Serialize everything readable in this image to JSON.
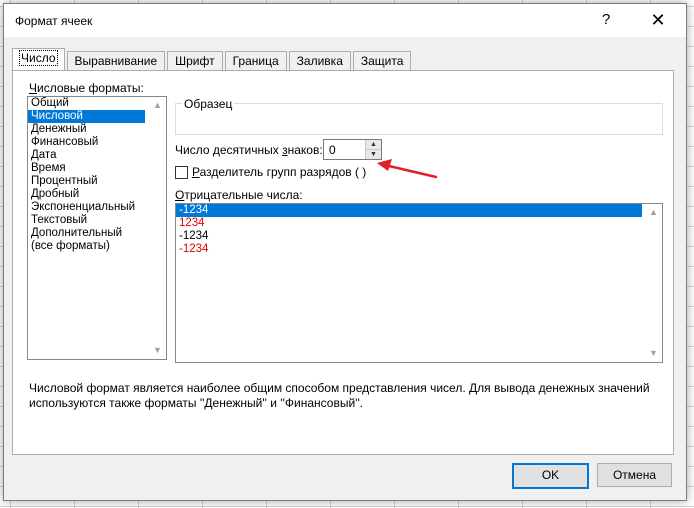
{
  "window": {
    "title": "Формат ячеек",
    "help_glyph": "?",
    "close_glyph": "✕"
  },
  "tabs": [
    {
      "label": "Число",
      "active": true
    },
    {
      "label": "Выравнивание"
    },
    {
      "label": "Шрифт"
    },
    {
      "label": "Граница"
    },
    {
      "label": "Заливка"
    },
    {
      "label": "Защита"
    }
  ],
  "categories": {
    "label_u": "Ч",
    "label_rest": "исловые форматы:",
    "items": [
      "Общий",
      "Числовой",
      "Денежный",
      "Финансовый",
      "Дата",
      "Время",
      "Процентный",
      "Дробный",
      "Экспоненциальный",
      "Текстовый",
      "Дополнительный",
      "(все форматы)"
    ],
    "selected": "Числовой"
  },
  "sample": {
    "label": "Образец",
    "value": ""
  },
  "decimals": {
    "label_pre": "Число десятичных ",
    "label_u": "з",
    "label_post": "наков:",
    "value": "0"
  },
  "separator": {
    "label_pre": "Р",
    "label_rest": "азделитель групп разрядов ( )",
    "checked": false
  },
  "negative": {
    "label_u": "О",
    "label_rest": "трицательные числа:",
    "items": [
      {
        "text": "-1234",
        "selected": true,
        "red": false
      },
      {
        "text": "1234",
        "red": true
      },
      {
        "text": "-1234",
        "red": false
      },
      {
        "text": "-1234",
        "red": true
      }
    ]
  },
  "description": "Числовой формат является наиболее общим способом представления чисел. Для вывода денежных значений используются также форматы ''Денежный'' и ''Финансовый''.",
  "buttons": {
    "ok": "OK",
    "cancel": "Отмена"
  },
  "colors": {
    "selection": "#0078d7",
    "negative_red": "#e00000",
    "annotation_arrow": "#e31e24"
  }
}
